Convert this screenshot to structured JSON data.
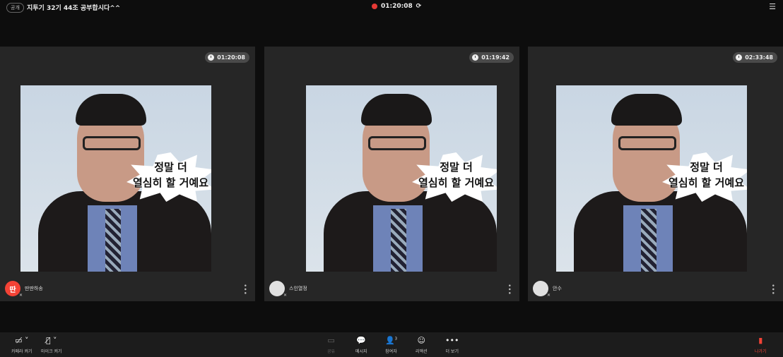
{
  "header": {
    "badge": "공개",
    "title": "지투기 32기 44조 공부합시다^^",
    "elapsed": "01:20:08"
  },
  "tiles": [
    {
      "name": "딴딴하송",
      "timer": "01:20:08",
      "avatar_letter": "딴"
    },
    {
      "name": "스인열정",
      "timer": "01:19:42",
      "avatar_letter": ""
    },
    {
      "name": "안수",
      "timer": "02:33:48",
      "avatar_letter": ""
    }
  ],
  "image_caption": {
    "line1": "정말 더",
    "line2": "열심히 할 거예요"
  },
  "toolbar": {
    "camera": "카메라 켜기",
    "mic": "마이크 켜기",
    "share": "공유",
    "message": "메시지",
    "participants": "참여자",
    "participants_count": "3",
    "reaction": "리액션",
    "more": "더 보기",
    "leave": "나가기"
  },
  "colors": {
    "accent": "#f44336"
  }
}
